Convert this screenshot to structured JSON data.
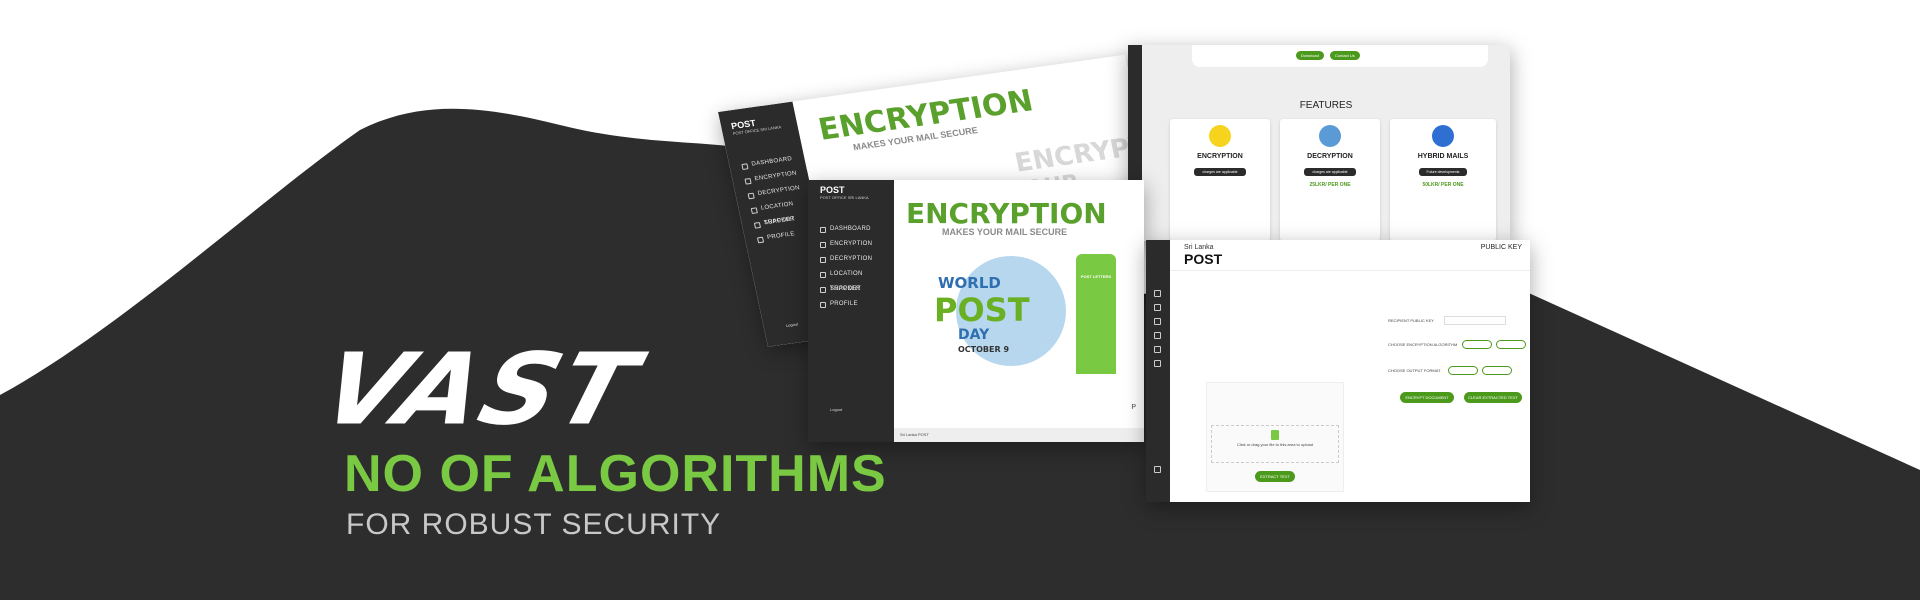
{
  "hero": {
    "title": "VAST",
    "highlight": "NO OF ALGORITHMS",
    "subtitle": "FOR ROBUST SECURITY"
  },
  "colors": {
    "dark_bg": "#2d2d2d",
    "accent_green": "#7ac943",
    "brand_green": "#4c9a1c",
    "muted_text": "#c8c8c8"
  },
  "screen_back": {
    "logo_main": "POST",
    "logo_sub": "POST OFFICE SRI LANKA",
    "nav": [
      "DASHBOARD",
      "ENCRYPTION",
      "DECRYPTION",
      "LOCATION TRACKER",
      "SUPPORT",
      "PROFILE"
    ],
    "logout": "Logout",
    "banner_title": "ENCRYPTION",
    "banner_sub": "MAKES YOUR MAIL SECURE",
    "ghost_title": "ENCRYPTI",
    "ghost_sub": "YOUR DOCUMENT"
  },
  "screen_front": {
    "logo_main": "POST",
    "logo_sub": "POST OFFICE SRI LANKA",
    "nav": [
      "DASHBOARD",
      "ENCRYPTION",
      "DECRYPTION",
      "LOCATION TRACKER",
      "SUPPORT",
      "PROFILE"
    ],
    "logout": "Logout",
    "banner_title": "ENCRYPTION",
    "banner_sub": "MAKES YOUR MAIL SECURE",
    "poster_line1": "WORLD",
    "poster_line2": "POST",
    "poster_line3": "DAY",
    "poster_date": "OCTOBER 9",
    "mailbox_label": "POST LETTERS",
    "footer_brand": "Sri Lanka POST",
    "footer_letter": "P"
  },
  "screen_features": {
    "top_buttons": [
      "Download",
      "Contact Us"
    ],
    "heading": "FEATURES",
    "cards": [
      {
        "title": "ENCRYPTION",
        "button": "charges are applicable",
        "price": ""
      },
      {
        "title": "DECRYPTION",
        "button": "charges are applicable",
        "price": "25LKR/ PER ONE"
      },
      {
        "title": "HYBRID MAILS",
        "button": "Future developments",
        "price": "50LKR/ PER ONE"
      }
    ]
  },
  "screen_encrypt": {
    "brand_line1": "Sri Lanka",
    "brand_line2": "POST",
    "header_right": "PUBLIC KEY",
    "fields": [
      "RECIPIENT PUBLIC KEY",
      "CHOOSE ENCRYPTION ALGORITHM",
      "CHOOSE OUTPUT FORMAT"
    ],
    "upload_title": "Click or drag your file to this area to upload",
    "extract_button": "EXTRACT TEXT",
    "encrypt_button": "ENCRYPT DOCUMENT",
    "clear_button": "CLEAR EXTRACTED TEXT"
  }
}
